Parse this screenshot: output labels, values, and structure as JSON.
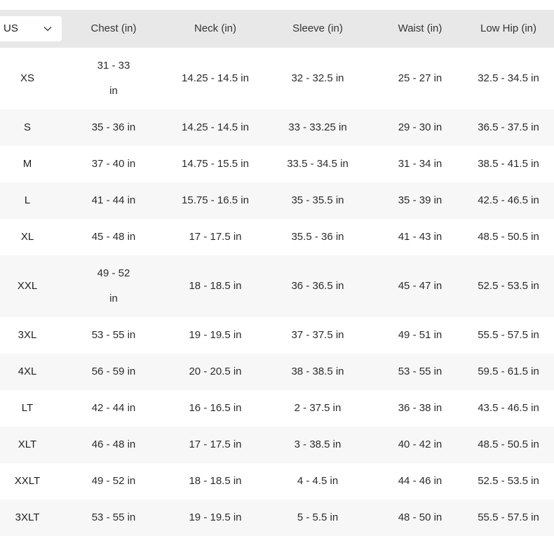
{
  "unit_selector": {
    "selected": "US",
    "icon": "chevron-down-icon"
  },
  "table": {
    "columns": [
      "Chest (in)",
      "Neck (in)",
      "Sleeve (in)",
      "Waist (in)",
      "Low Hip (in)"
    ],
    "rows": [
      {
        "size": "XS",
        "chest": "31 - 33 in",
        "neck": "14.25 - 14.5 in",
        "sleeve": "32 - 32.5 in",
        "waist": "25 - 27 in",
        "low_hip": "32.5 - 34.5 in"
      },
      {
        "size": "S",
        "chest": "35 - 36 in",
        "neck": "14.25 - 14.5 in",
        "sleeve": "33 - 33.25 in",
        "waist": "29 - 30 in",
        "low_hip": "36.5 - 37.5 in"
      },
      {
        "size": "M",
        "chest": "37 - 40 in",
        "neck": "14.75 - 15.5 in",
        "sleeve": "33.5 - 34.5 in",
        "waist": "31 - 34 in",
        "low_hip": "38.5 - 41.5 in"
      },
      {
        "size": "L",
        "chest": "41 - 44 in",
        "neck": "15.75 - 16.5 in",
        "sleeve": "35 - 35.5 in",
        "waist": "35 - 39 in",
        "low_hip": "42.5 - 46.5 in"
      },
      {
        "size": "XL",
        "chest": "45 - 48 in",
        "neck": "17 - 17.5 in",
        "sleeve": "35.5 - 36 in",
        "waist": "41 - 43 in",
        "low_hip": "48.5 - 50.5 in"
      },
      {
        "size": "XXL",
        "chest": "49 - 52 in",
        "neck": "18 - 18.5 in",
        "sleeve": "36 - 36.5 in",
        "waist": "45 - 47 in",
        "low_hip": "52.5 - 53.5 in"
      },
      {
        "size": "3XL",
        "chest": "53 - 55 in",
        "neck": "19 - 19.5 in",
        "sleeve": "37 - 37.5 in",
        "waist": "49 - 51 in",
        "low_hip": "55.5 - 57.5 in"
      },
      {
        "size": "4XL",
        "chest": "56 - 59 in",
        "neck": "20 - 20.5 in",
        "sleeve": "38 - 38.5 in",
        "waist": "53 - 55 in",
        "low_hip": "59.5 - 61.5 in"
      },
      {
        "size": "LT",
        "chest": "42 - 44 in",
        "neck": "16 - 16.5 in",
        "sleeve": "2 - 37.5 in",
        "waist": "36 - 38 in",
        "low_hip": "43.5 - 46.5 in"
      },
      {
        "size": "XLT",
        "chest": "46 - 48 in",
        "neck": "17 - 17.5 in",
        "sleeve": "3 - 38.5 in",
        "waist": "40 - 42 in",
        "low_hip": "48.5 - 50.5 in"
      },
      {
        "size": "XXLT",
        "chest": "49 - 52 in",
        "neck": "18 - 18.5 in",
        "sleeve": "4 - 4.5 in",
        "waist": "44 - 46 in",
        "low_hip": "52.5 - 53.5 in"
      },
      {
        "size": "3XLT",
        "chest": "53 - 55 in",
        "neck": "19 - 19.5 in",
        "sleeve": "5 - 5.5 in",
        "waist": "48 - 50 in",
        "low_hip": "55.5 - 57.5 in"
      }
    ]
  }
}
